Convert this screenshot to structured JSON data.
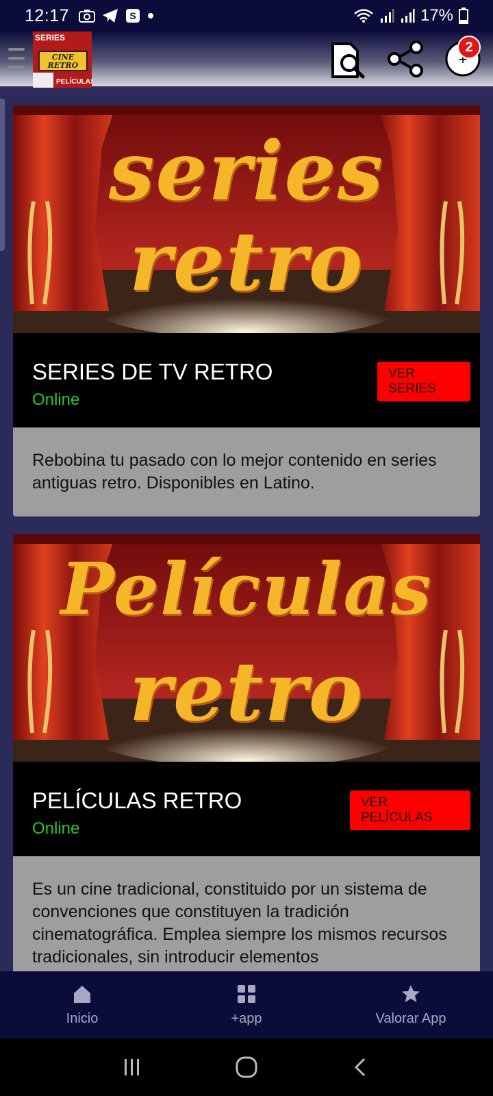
{
  "status_bar": {
    "time": "12:17",
    "battery": "17%"
  },
  "app_bar": {
    "logo_top": "SERIES",
    "logo_mid": "CINE RETRO",
    "logo_bottom": "PELÍCULAS",
    "notification_count": "2"
  },
  "cards": [
    {
      "banner_line1": "series",
      "banner_line2": "retro",
      "title": "SERIES DE TV RETRO",
      "status": "Online",
      "button": "VER SERIES",
      "description": "Rebobina tu pasado con lo mejor contenido en series antiguas retro. Disponibles en Latino."
    },
    {
      "banner_line1": "Películas",
      "banner_line2": "retro",
      "title": "PELÍCULAS RETRO",
      "status": "Online",
      "button": "VER PELÍCULAS",
      "description": "Es un cine tradicional, constituido por un sistema de convenciones que constituyen la tradición cinematográfica. Emplea siempre los mismos recursos tradicionales, sin introducir elementos"
    }
  ],
  "bottom_nav": [
    {
      "label": "Inicio",
      "icon": "home-icon"
    },
    {
      "label": "+app",
      "icon": "apps-grid-icon"
    },
    {
      "label": "Valorar App",
      "icon": "star-icon"
    }
  ],
  "colors": {
    "accent": "#ff0000",
    "online": "#2dc52d",
    "nav_bg": "#0c0c3a"
  }
}
